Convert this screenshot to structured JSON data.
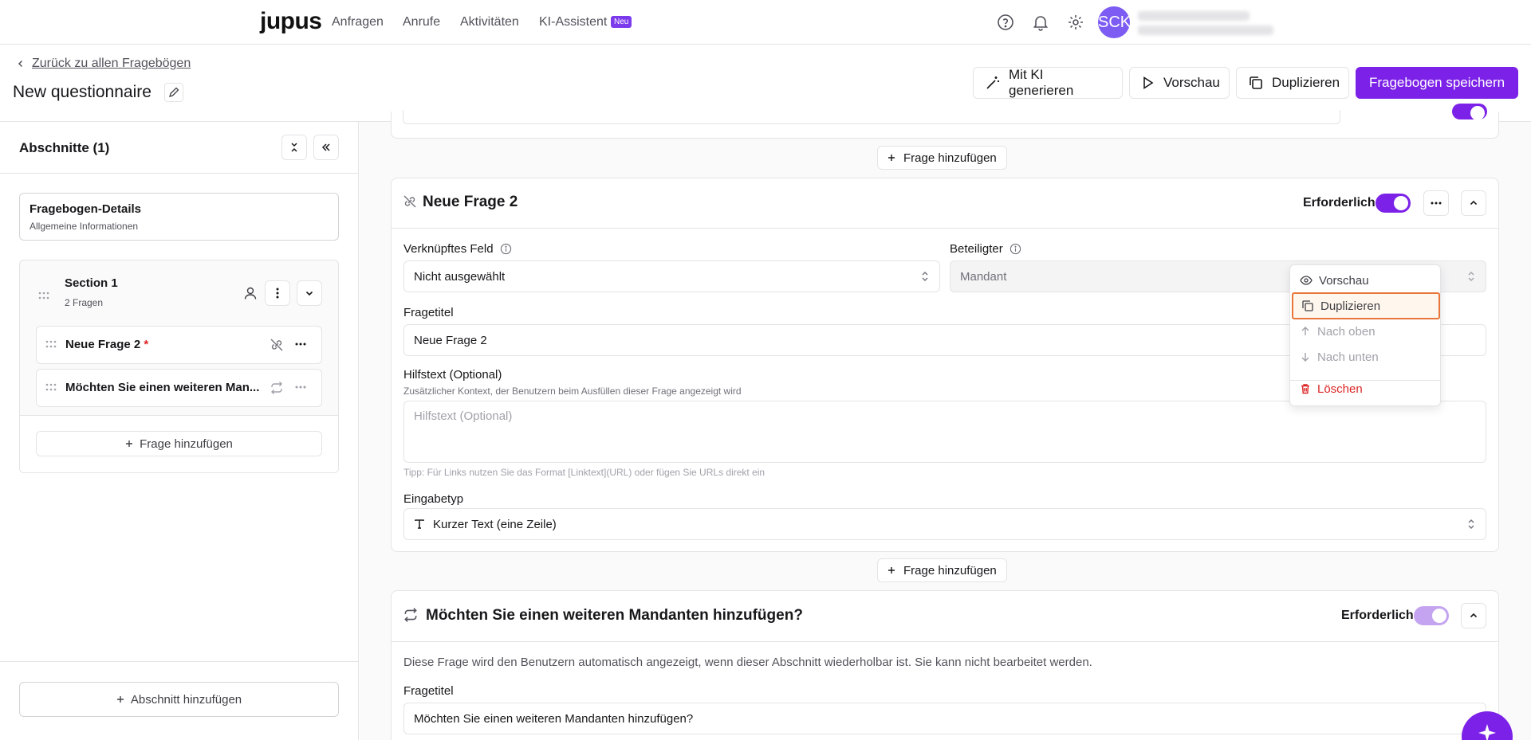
{
  "nav": {
    "logo": "jupus",
    "items": [
      "Anfragen",
      "Anrufe",
      "Aktivitäten",
      "KI-Assistent"
    ],
    "new_badge": "Neu",
    "avatar": "SCK"
  },
  "header": {
    "back_label": "Zurück zu allen Fragebögen",
    "title": "New questionnaire",
    "buttons": {
      "ai": "Mit KI generieren",
      "preview": "Vorschau",
      "duplicate": "Duplizieren",
      "save": "Fragebogen speichern"
    }
  },
  "sidebar": {
    "title": "Abschnitte (1)",
    "details": {
      "title": "Fragebogen-Details",
      "subtitle": "Allgemeine Informationen"
    },
    "section": {
      "title": "Section 1",
      "subtitle": "2 Fragen",
      "questions": [
        {
          "label": "Neue Frage 2",
          "required_mark": "*"
        },
        {
          "label": "Möchten Sie einen weiteren Man..."
        }
      ],
      "add_question": "Frage hinzufügen"
    },
    "add_section": "Abschnitt hinzufügen"
  },
  "main": {
    "add_question": "Frage hinzufügen",
    "question1": {
      "title": "Neue Frage 2",
      "required_label": "Erforderlich",
      "required": true,
      "linked_field_label": "Verknüpftes Feld",
      "linked_field_value": "Nicht ausgewählt",
      "participant_label": "Beteiligter",
      "participant_value": "Mandant",
      "question_title_label": "Fragetitel",
      "question_title_value": "Neue Frage 2",
      "help_label": "Hilfstext (Optional)",
      "help_description": "Zusätzlicher Kontext, der Benutzern beim Ausfüllen dieser Frage angezeigt wird",
      "help_placeholder": "Hilfstext (Optional)",
      "help_tip": "Tipp: Für Links nutzen Sie das Format [Linktext](URL) oder fügen Sie URLs direkt ein",
      "input_type_label": "Eingabetyp",
      "input_type_value": "Kurzer Text (eine Zeile)"
    },
    "question2": {
      "title": "Möchten Sie einen weiteren Mandanten hinzufügen?",
      "required_label": "Erforderlich",
      "required": true,
      "notice": "Diese Frage wird den Benutzern automatisch angezeigt, wenn dieser Abschnitt wiederholbar ist. Sie kann nicht bearbeitet werden.",
      "question_title_label": "Fragetitel",
      "question_title_value": "Möchten Sie einen weiteren Mandanten hinzufügen?"
    }
  },
  "menu": {
    "items": [
      "Vorschau",
      "Duplizieren",
      "Nach oben",
      "Nach unten",
      "Löschen"
    ],
    "highlighted": "Duplizieren"
  },
  "colors": {
    "accent": "#7c22e8",
    "danger": "#dc2626",
    "highlight_border": "#e8753a"
  }
}
